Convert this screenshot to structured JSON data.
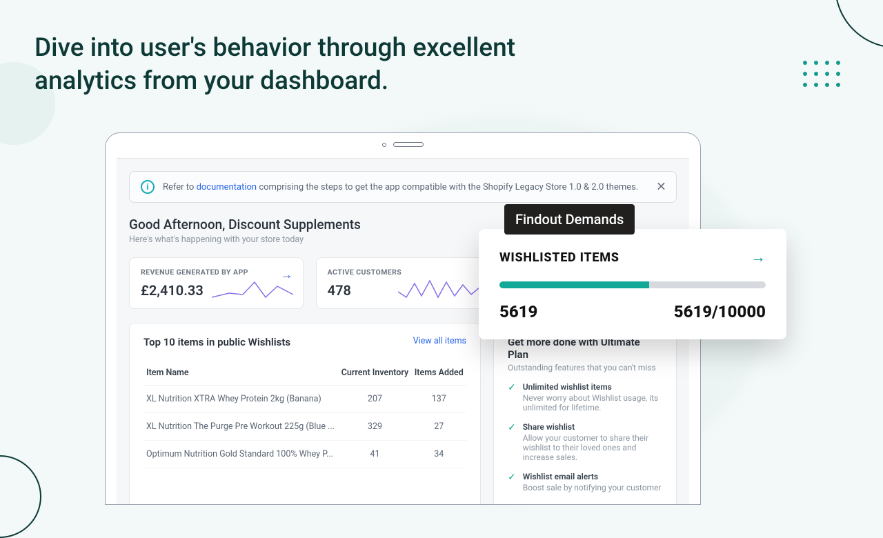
{
  "headline": "Dive into user's behavior through excellent analytics from your dashboard.",
  "banner": {
    "prefix": "Refer to ",
    "link": "documentation",
    "suffix": " comprising the steps to get the app compatible with the Shopify Legacy Store 1.0 & 2.0 themes."
  },
  "greeting": {
    "title": "Good Afternoon, Discount Supplements",
    "sub": "Here's what's happening with your store today"
  },
  "stats": {
    "revenue": {
      "label": "REVENUE GENERATED BY APP",
      "value": "£2,410.33"
    },
    "active": {
      "label": "ACTIVE CUSTOMERS",
      "value": "478"
    }
  },
  "top10": {
    "title": "Top 10 items in public Wishlists",
    "viewall": "View all items",
    "cols": [
      "Item Name",
      "Current Inventory",
      "Items Added"
    ],
    "rows": [
      {
        "name": "XL Nutrition XTRA Whey Protein 2kg (Banana)",
        "inv": "207",
        "added": "137"
      },
      {
        "name": "XL Nutrition The Purge Pre Workout 225g (Blue ...",
        "inv": "329",
        "added": "27"
      },
      {
        "name": "Optimum Nutrition Gold Standard 100% Whey P...",
        "inv": "41",
        "added": "34"
      }
    ]
  },
  "ultimate": {
    "title": "Get more done with Ultimate Plan",
    "sub": "Outstanding features that you can't miss",
    "features": [
      {
        "t": "Unlimited wishlist items",
        "d": "Never worry about Wishlist usage, its unlimited for lifetime."
      },
      {
        "t": "Share wishlist",
        "d": "Allow your customer to share their wishlist to their loved ones and increase sales."
      },
      {
        "t": "Wishlist email alerts",
        "d": "Boost sale by notifying your customer"
      }
    ]
  },
  "overlay": {
    "label": "Findout Demands",
    "title": "WISHLISTED ITEMS",
    "count": "5619",
    "ratio": "5619/10000"
  }
}
